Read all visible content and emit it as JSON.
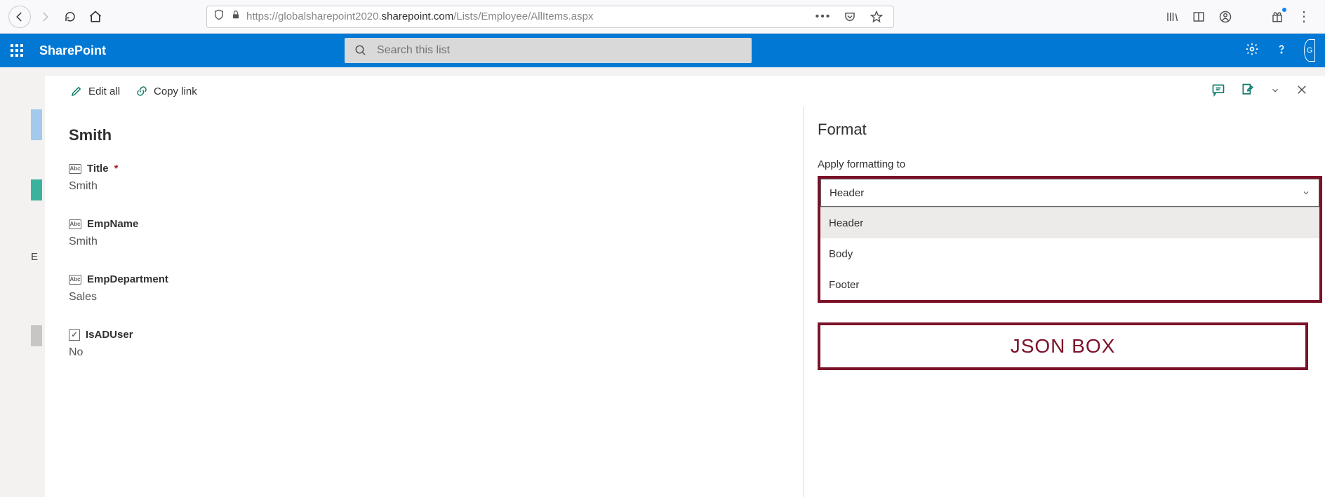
{
  "browser": {
    "url_prefix": "https://globalsharepoint2020.",
    "url_domain": "sharepoint.com",
    "url_suffix": "/Lists/Employee/AllItems.aspx"
  },
  "sp_header": {
    "title": "SharePoint",
    "search_placeholder": "Search this list",
    "avatar_initials": "G"
  },
  "left_rail": {
    "label": "E"
  },
  "command_bar": {
    "edit_all": "Edit all",
    "copy_link": "Copy link"
  },
  "form": {
    "title": "Smith",
    "fields": [
      {
        "type": "text",
        "label": "Title",
        "required": true,
        "value": "Smith"
      },
      {
        "type": "text",
        "label": "EmpName",
        "required": false,
        "value": "Smith"
      },
      {
        "type": "text",
        "label": "EmpDepartment",
        "required": false,
        "value": "Sales"
      },
      {
        "type": "bool",
        "label": "IsADUser",
        "required": false,
        "value": "No"
      }
    ]
  },
  "format_pane": {
    "title": "Format",
    "apply_label": "Apply formatting to",
    "selected": "Header",
    "options": [
      "Header",
      "Body",
      "Footer"
    ],
    "json_box": "JSON BOX"
  }
}
